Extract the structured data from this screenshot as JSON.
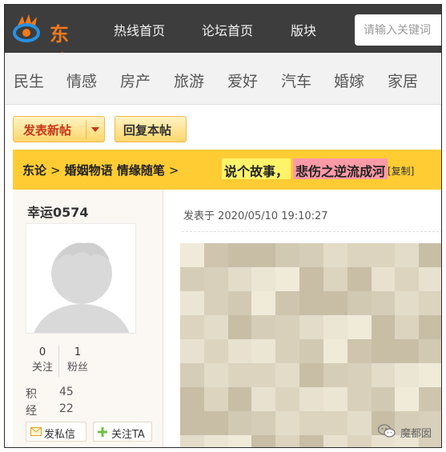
{
  "brand": {
    "logo_text": "东论",
    "accent": "#f07a1c"
  },
  "topnav": {
    "items": [
      "热线首页",
      "论坛首页",
      "版块"
    ],
    "search_placeholder": "请输入关键词"
  },
  "categories": [
    "民生",
    "情感",
    "房产",
    "旅游",
    "爱好",
    "汽车",
    "婚嫁",
    "家居"
  ],
  "actions": {
    "new_post": "发表新帖",
    "reply": "回复本帖"
  },
  "breadcrumb": {
    "items": [
      "东论",
      "婚姻物语 情缘随笔"
    ],
    "separator": ">",
    "title_part1": "说个故事，",
    "title_part2": "悲伤之逆流成河",
    "copy_label": "[复制]"
  },
  "author": {
    "name": "幸运0574",
    "following": "0",
    "following_label": "关注",
    "followers": "1",
    "followers_label": "粉丝",
    "points_label": "积",
    "points": "45",
    "exp_label": "经",
    "exp": "22",
    "message_btn": "发私信",
    "follow_btn": "关注TA"
  },
  "post": {
    "time": "发表于 2020/05/10 19:10:27"
  },
  "watermark": {
    "label": "魔都囡"
  }
}
